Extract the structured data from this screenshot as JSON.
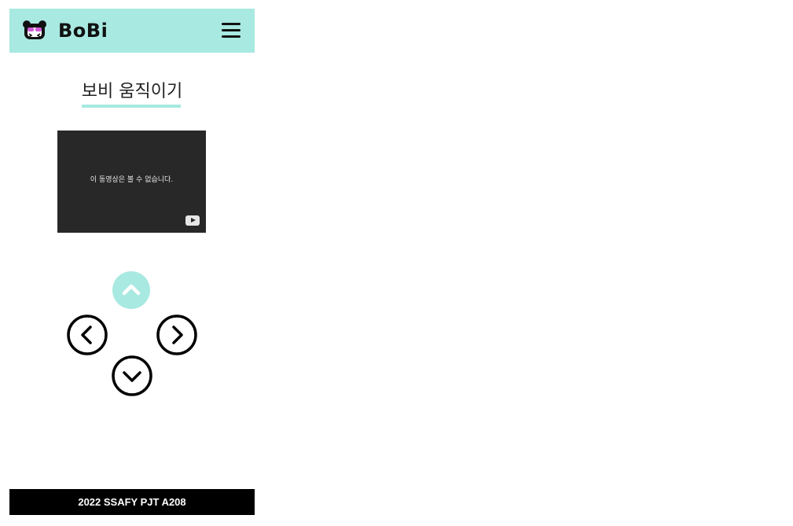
{
  "header": {
    "brand": "BoBi",
    "logo_icon": "panda-logo-icon",
    "menu_icon": "hamburger-menu-icon",
    "background": "#a8e9e1"
  },
  "page": {
    "title": "보비 움직이기",
    "accent": "#a8e9e1"
  },
  "video": {
    "message": "이 동영상은 볼 수 없습니다.",
    "logo_icon": "youtube-icon"
  },
  "controls": {
    "up": {
      "icon": "chevron-up-icon",
      "active": true
    },
    "left": {
      "icon": "chevron-left-icon",
      "active": false
    },
    "right": {
      "icon": "chevron-right-icon",
      "active": false
    },
    "down": {
      "icon": "chevron-down-icon",
      "active": false
    }
  },
  "footer": {
    "text": "2022 SSAFY PJT A208"
  }
}
